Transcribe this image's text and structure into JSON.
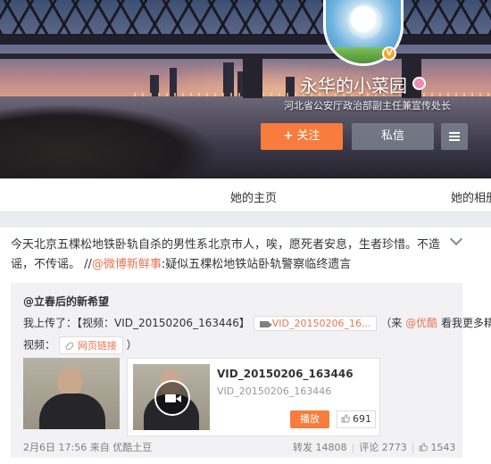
{
  "profile": {
    "name": "永华的小菜园",
    "description": "河北省公安厅政治部副主任兼宣传处长",
    "verified_badge": "V",
    "follow_label": "关注",
    "follow_plus": "+",
    "message_label": "私信"
  },
  "tabs": [
    {
      "label": "她的主页"
    },
    {
      "label": "她的相册"
    }
  ],
  "post": {
    "text": "今天北京五棵松地铁卧轨自杀的男性系北京市人，唉，愿死者安息，生者珍惜。不造谣，不传谣。 //",
    "mention": "@微博新鲜事",
    "mention_text": ":疑似五棵松地铁站卧轨警察临终遗言",
    "repost": {
      "author": "@立春后的新希望",
      "line1_prefix": "我上传了：【视频：VID_20150206_163446】",
      "video_chip": "VID_20150206_16...",
      "line1_suffix_open": "（来",
      "source_mention": "@优酷",
      "line1_suffix": "看我更多精彩",
      "line2_prefix": "视频：",
      "web_link": "网页链接",
      "line2_suffix": "）",
      "video_card": {
        "title": "VID_20150206_163446",
        "subtitle": "VID_20150206_163446",
        "play_label": "播放",
        "likes": "691"
      },
      "footer": {
        "time": "2月6日 17:56",
        "source": "来自 优酷土豆",
        "repost_label": "转发 14808",
        "comment_label": "评论 2773",
        "likes": "1543"
      }
    }
  },
  "colors": {
    "accent_orange": "#f77c3d",
    "link_orange": "#eb7350"
  }
}
